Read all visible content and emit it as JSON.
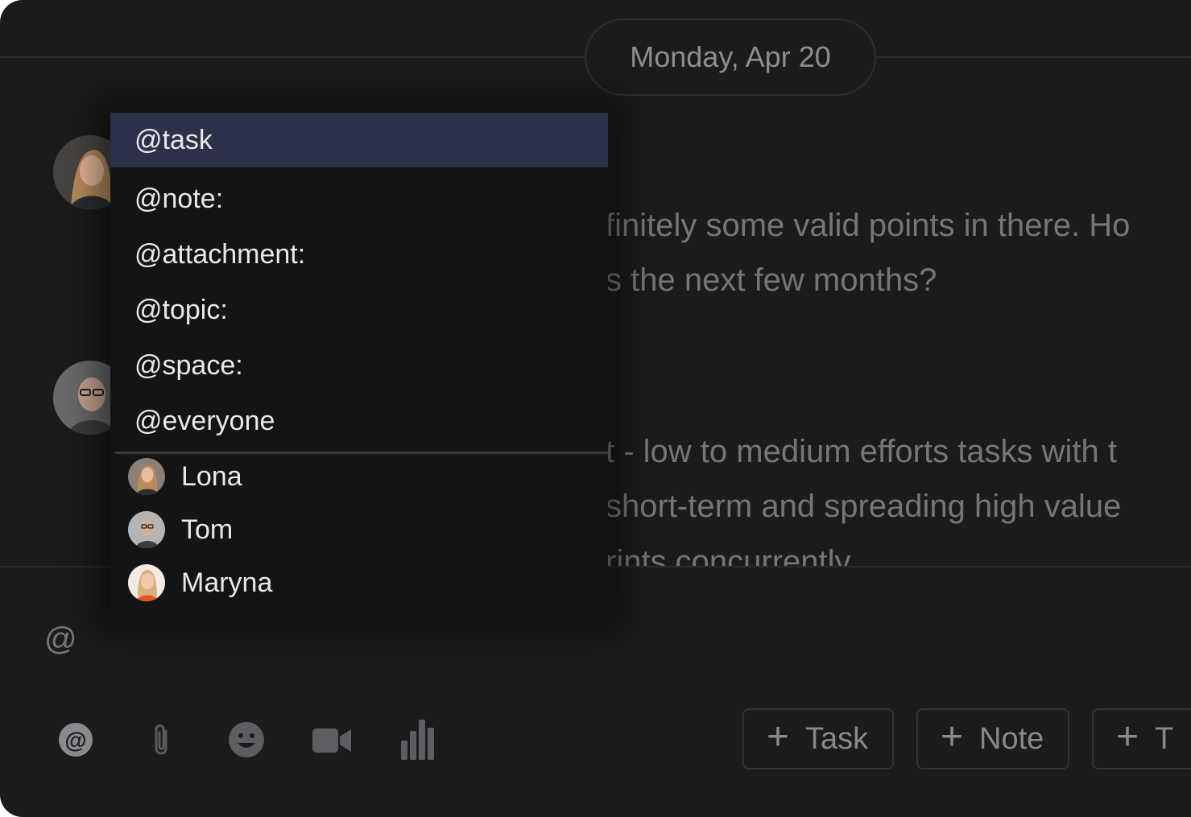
{
  "timeline": {
    "date_label": "Monday, Apr 20"
  },
  "messages": [
    {
      "lines": [
        "finitely some valid points in there. Ho",
        "s the next few months?"
      ]
    },
    {
      "lines": [
        "t - low to medium efforts tasks with t",
        "short-term and spreading high value",
        "rints concurrently"
      ]
    }
  ],
  "composer": {
    "input_value": "@"
  },
  "mention_menu": {
    "selected_index": 0,
    "items": [
      "@task",
      "@note:",
      "@attachment:",
      "@topic:",
      "@space:",
      "@everyone"
    ],
    "people": [
      "Lona",
      "Tom",
      "Maryna"
    ]
  },
  "toolbar": {
    "icons": [
      "mention-icon",
      "paperclip-icon",
      "emoji-icon",
      "video-icon",
      "chart-icon"
    ],
    "actions": [
      "Task",
      "Note",
      "T"
    ]
  },
  "colors": {
    "background": "#1b1b1c",
    "menu": "#141415",
    "selected": "#2c3048",
    "text": "#e9e9ec",
    "muted": "#76767a"
  }
}
